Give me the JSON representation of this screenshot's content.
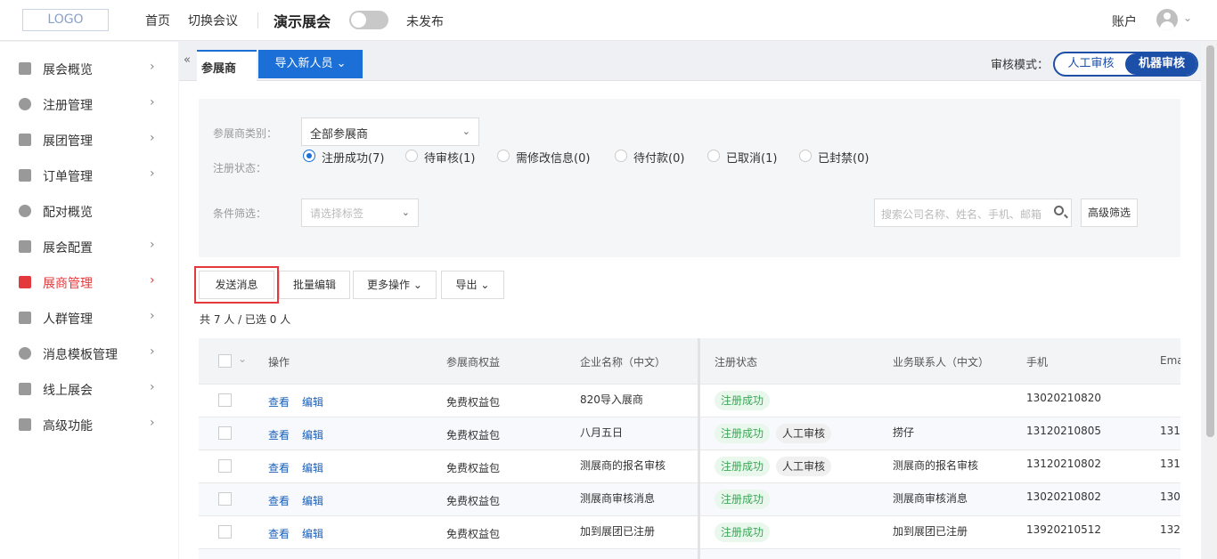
{
  "topbar": {
    "logo": "LOGO",
    "nav": [
      "首页",
      "切换会议"
    ],
    "conference_name": "演示展会",
    "publish_state": "未发布",
    "account": "账户"
  },
  "sidebar": {
    "items": [
      {
        "label": "展会概览",
        "icon": "dashboard-icon"
      },
      {
        "label": "注册管理",
        "icon": "user-register-icon"
      },
      {
        "label": "展团管理",
        "icon": "group-icon"
      },
      {
        "label": "订单管理",
        "icon": "order-icon"
      },
      {
        "label": "配对概览",
        "icon": "match-icon"
      },
      {
        "label": "展会配置",
        "icon": "config-icon"
      },
      {
        "label": "展商管理",
        "icon": "store-icon",
        "active": true
      },
      {
        "label": "人群管理",
        "icon": "people-icon"
      },
      {
        "label": "消息模板管理",
        "icon": "bell-icon"
      },
      {
        "label": "线上展会",
        "icon": "monitor-icon"
      },
      {
        "label": "高级功能",
        "icon": "tag-icon"
      }
    ]
  },
  "tabs": {
    "active": "参展商",
    "import_button": "导入新人员"
  },
  "review_mode": {
    "label": "审核模式：",
    "options": [
      "人工审核",
      "机器审核"
    ],
    "selected": "机器审核"
  },
  "filters": {
    "category_label": "参展商类别：",
    "category_value": "全部参展商",
    "status_label": "注册状态：",
    "statuses": [
      {
        "label": "注册成功(7)",
        "checked": true
      },
      {
        "label": "待审核(1)",
        "checked": false
      },
      {
        "label": "需修改信息(0)",
        "checked": false
      },
      {
        "label": "待付款(0)",
        "checked": false
      },
      {
        "label": "已取消(1)",
        "checked": false
      },
      {
        "label": "已封禁(0)",
        "checked": false
      }
    ],
    "condition_label": "条件筛选：",
    "tag_placeholder": "请选择标签",
    "search_placeholder": "搜索公司名称、姓名、手机、邮箱",
    "advanced_button": "高级筛选"
  },
  "actions": {
    "send_message": "发送消息",
    "batch_edit": "批量编辑",
    "more_actions": "更多操作",
    "export": "导出"
  },
  "summary": "共 7 人 / 已选 0 人",
  "table": {
    "headers": [
      "操作",
      "参展商权益",
      "企业名称（中文）",
      "注册状态",
      "业务联系人（中文）",
      "手机",
      "Ema"
    ],
    "rows": [
      {
        "view": "查看",
        "edit": "编辑",
        "benefit": "免费权益包",
        "company": "820导入展商",
        "status": "注册成功",
        "review": "",
        "contact": "",
        "phone": "13020210820",
        "email": ""
      },
      {
        "view": "查看",
        "edit": "编辑",
        "benefit": "免费权益包",
        "company": "八月五日",
        "status": "注册成功",
        "review": "人工审核",
        "contact": "捞仔",
        "phone": "13120210805",
        "email": "131"
      },
      {
        "view": "查看",
        "edit": "编辑",
        "benefit": "免费权益包",
        "company": "测展商的报名审核",
        "status": "注册成功",
        "review": "人工审核",
        "contact": "测展商的报名审核",
        "phone": "13120210802",
        "email": "131"
      },
      {
        "view": "查看",
        "edit": "编辑",
        "benefit": "免费权益包",
        "company": "测展商审核消息",
        "status": "注册成功",
        "review": "",
        "contact": "测展商审核消息",
        "phone": "13020210802",
        "email": "130"
      },
      {
        "view": "查看",
        "edit": "编辑",
        "benefit": "免费权益包",
        "company": "加到展团已注册",
        "status": "注册成功",
        "review": "",
        "contact": "加到展团已注册",
        "phone": "13920210512",
        "email": "132"
      }
    ]
  },
  "colors": {
    "primary": "#1b6fd6",
    "active_menu": "#e4393c",
    "success": "#3aa757"
  }
}
